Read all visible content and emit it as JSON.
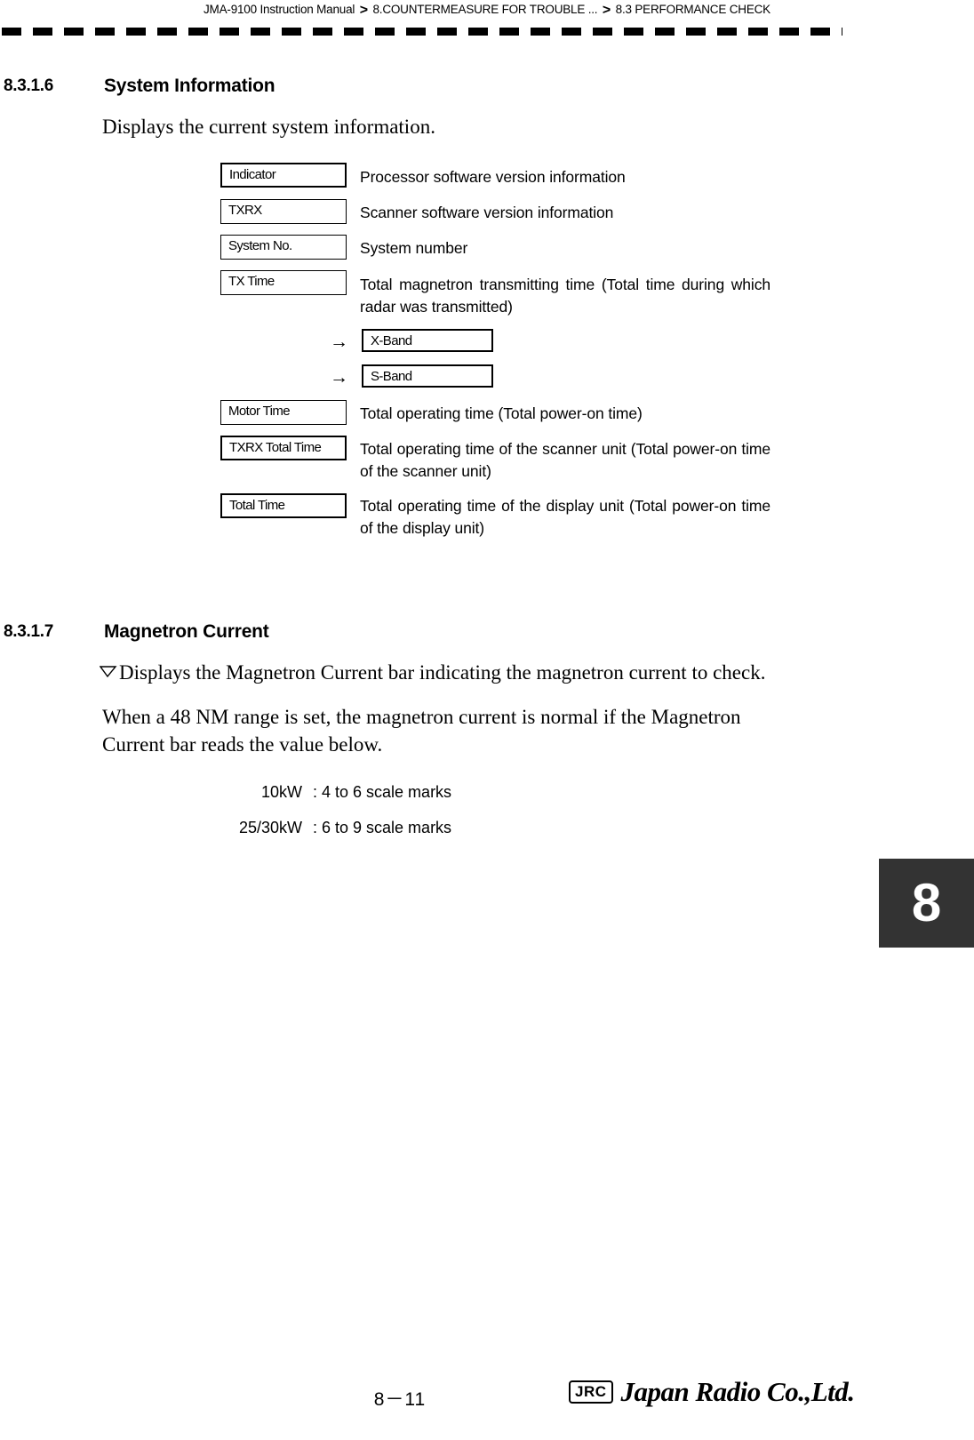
{
  "header": {
    "manual": "JMA-9100 Instruction Manual",
    "separator": ">",
    "chapter": "8.COUNTERMEASURE FOR TROUBLE ...",
    "section": "8.3  PERFORMANCE CHECK"
  },
  "sections": [
    {
      "number": "8.3.1.6",
      "title": "System Information",
      "intro": "Displays the current system information."
    },
    {
      "number": "8.3.1.7",
      "title": "Magnetron Current",
      "bullet_text": "Displays the Magnetron Current bar indicating the magnetron current to check.",
      "paragraph": "When a 48 NM range is set, the magnetron current is normal if the Magnetron Current bar reads the value below."
    }
  ],
  "system_info_rows": [
    {
      "label": "Indicator",
      "description": "Processor software version information"
    },
    {
      "label": "TXRX",
      "description": "Scanner software version information"
    },
    {
      "label": "System No.",
      "description": "System number"
    },
    {
      "label": "TX Time",
      "description": "Total magnetron transmitting time (Total time during which radar was transmitted)"
    },
    {
      "label": "Motor Time",
      "description": "Total operating time (Total power-on time)"
    },
    {
      "label": "TXRX Total Time",
      "description": "Total operating time of the scanner unit (Total power-on time of the scanner unit)"
    },
    {
      "label": "Total Time",
      "description": "Total operating time of the display unit (Total power-on time of the display unit)"
    }
  ],
  "tx_time_subitems": [
    {
      "arrow": "→",
      "label": "X-Band"
    },
    {
      "arrow": "→",
      "label": "S-Band"
    }
  ],
  "magnetron_scale_table": [
    {
      "power": "10kW",
      "value": ": 4 to 6 scale marks"
    },
    {
      "power": "25/30kW",
      "value": ": 6 to 9 scale marks"
    }
  ],
  "chapter_tab": {
    "number": "8",
    "color": "#333333"
  },
  "footer": {
    "page": "8－11",
    "logo_mark": "JRC",
    "company": "Japan Radio Co.,Ltd."
  }
}
